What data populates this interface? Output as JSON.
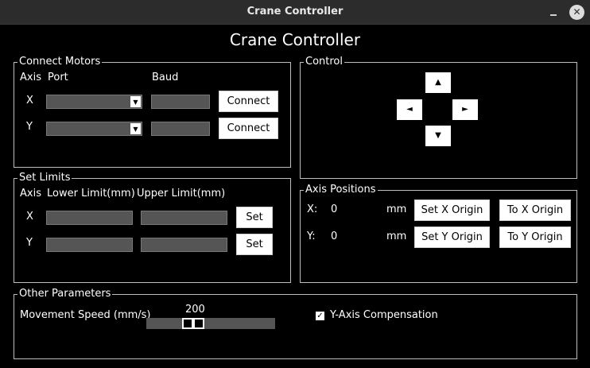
{
  "window": {
    "title": "Crane Controller"
  },
  "heading": "Crane Controller",
  "connect_motors": {
    "title": "Connect Motors",
    "headers": {
      "axis": "Axis",
      "port": "Port",
      "baud": "Baud"
    },
    "rows": [
      {
        "axis": "X",
        "port": "",
        "baud": "",
        "button": "Connect"
      },
      {
        "axis": "Y",
        "port": "",
        "baud": "",
        "button": "Connect"
      }
    ]
  },
  "control": {
    "title": "Control",
    "up": "▲",
    "down": "▼",
    "left": "◄",
    "right": "►"
  },
  "set_limits": {
    "title": "Set Limits",
    "headers": {
      "axis": "Axis",
      "lower": "Lower Limit(mm)",
      "upper": "Upper Limit(mm)"
    },
    "rows": [
      {
        "axis": "X",
        "lower": "",
        "upper": "",
        "button": "Set"
      },
      {
        "axis": "Y",
        "lower": "",
        "upper": "",
        "button": "Set"
      }
    ]
  },
  "axis_positions": {
    "title": "Axis Positions",
    "rows": [
      {
        "label": "X:",
        "value": "0",
        "unit": "mm",
        "set_origin": "Set X Origin",
        "to_origin": "To X Origin"
      },
      {
        "label": "Y:",
        "value": "0",
        "unit": "mm",
        "set_origin": "Set Y Origin",
        "to_origin": "To Y Origin"
      }
    ]
  },
  "other_parameters": {
    "title": "Other Parameters",
    "speed_label": "Movement Speed (mm/s)",
    "speed_value": "200",
    "compensation_label": "Y-Axis Compensation",
    "compensation_checked": true
  }
}
